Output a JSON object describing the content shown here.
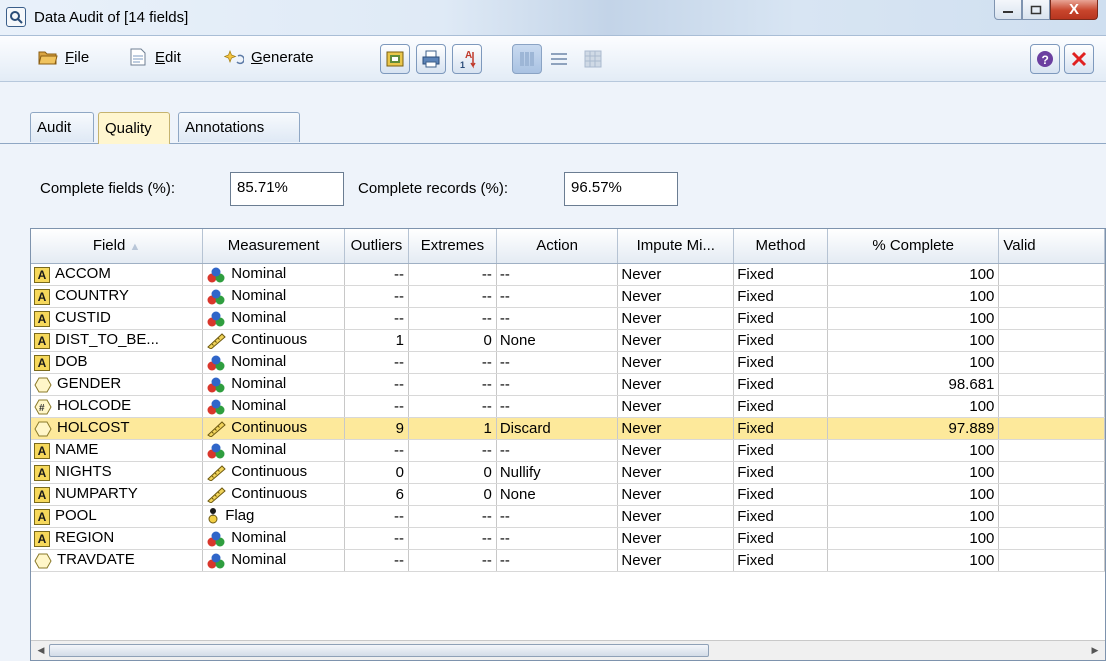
{
  "window": {
    "title": "Data Audit of [14 fields]",
    "minimize_icon": "minimize-icon",
    "maximize_icon": "maximize-icon",
    "close_label": "X"
  },
  "menu": {
    "file": "File",
    "edit": "Edit",
    "generate": "Generate"
  },
  "tabs": [
    {
      "label": "Audit",
      "active": false
    },
    {
      "label": "Quality",
      "active": true
    },
    {
      "label": "Annotations",
      "active": false
    }
  ],
  "complete": {
    "fields_label": "Complete fields (%):",
    "fields_value": "85.71%",
    "records_label": "Complete records (%):",
    "records_value": "96.57%"
  },
  "table": {
    "columns": [
      "Field",
      "Measurement",
      "Outliers",
      "Extremes",
      "Action",
      "Impute Mi...",
      "Method",
      "% Complete",
      "Valid"
    ],
    "rows": [
      {
        "type": "A",
        "field": "ACCOM",
        "measure": "Nominal",
        "mtype": "nominal",
        "outliers": "--",
        "extremes": "--",
        "action": "--",
        "impute": "Never",
        "method": "Fixed",
        "complete": "100",
        "highlight": false
      },
      {
        "type": "A",
        "field": "COUNTRY",
        "measure": "Nominal",
        "mtype": "nominal",
        "outliers": "--",
        "extremes": "--",
        "action": "--",
        "impute": "Never",
        "method": "Fixed",
        "complete": "100",
        "highlight": false
      },
      {
        "type": "A",
        "field": "CUSTID",
        "measure": "Nominal",
        "mtype": "nominal",
        "outliers": "--",
        "extremes": "--",
        "action": "--",
        "impute": "Never",
        "method": "Fixed",
        "complete": "100",
        "highlight": false
      },
      {
        "type": "A",
        "field": "DIST_TO_BE...",
        "measure": "Continuous",
        "mtype": "continuous",
        "outliers": "1",
        "extremes": "0",
        "action": "None",
        "impute": "Never",
        "method": "Fixed",
        "complete": "100",
        "highlight": false
      },
      {
        "type": "A",
        "field": "DOB",
        "measure": "Nominal",
        "mtype": "nominal",
        "outliers": "--",
        "extremes": "--",
        "action": "--",
        "impute": "Never",
        "method": "Fixed",
        "complete": "100",
        "highlight": false
      },
      {
        "type": "diamond",
        "field": "GENDER",
        "measure": "Nominal",
        "mtype": "nominal",
        "outliers": "--",
        "extremes": "--",
        "action": "--",
        "impute": "Never",
        "method": "Fixed",
        "complete": "98.681",
        "highlight": false
      },
      {
        "type": "hash",
        "field": "HOLCODE",
        "measure": "Nominal",
        "mtype": "nominal",
        "outliers": "--",
        "extremes": "--",
        "action": "--",
        "impute": "Never",
        "method": "Fixed",
        "complete": "100",
        "highlight": false
      },
      {
        "type": "diamond",
        "field": "HOLCOST",
        "measure": "Continuous",
        "mtype": "continuous",
        "outliers": "9",
        "extremes": "1",
        "action": "Discard",
        "impute": "Never",
        "method": "Fixed",
        "complete": "97.889",
        "highlight": true
      },
      {
        "type": "A",
        "field": "NAME",
        "measure": "Nominal",
        "mtype": "nominal",
        "outliers": "--",
        "extremes": "--",
        "action": "--",
        "impute": "Never",
        "method": "Fixed",
        "complete": "100",
        "highlight": false
      },
      {
        "type": "A",
        "field": "NIGHTS",
        "measure": "Continuous",
        "mtype": "continuous",
        "outliers": "0",
        "extremes": "0",
        "action": "Nullify",
        "impute": "Never",
        "method": "Fixed",
        "complete": "100",
        "highlight": false
      },
      {
        "type": "A",
        "field": "NUMPARTY",
        "measure": "Continuous",
        "mtype": "continuous",
        "outliers": "6",
        "extremes": "0",
        "action": "None",
        "impute": "Never",
        "method": "Fixed",
        "complete": "100",
        "highlight": false
      },
      {
        "type": "A",
        "field": "POOL",
        "measure": "Flag",
        "mtype": "flag",
        "outliers": "--",
        "extremes": "--",
        "action": "--",
        "impute": "Never",
        "method": "Fixed",
        "complete": "100",
        "highlight": false
      },
      {
        "type": "A",
        "field": "REGION",
        "measure": "Nominal",
        "mtype": "nominal",
        "outliers": "--",
        "extremes": "--",
        "action": "--",
        "impute": "Never",
        "method": "Fixed",
        "complete": "100",
        "highlight": false
      },
      {
        "type": "diamond",
        "field": "TRAVDATE",
        "measure": "Nominal",
        "mtype": "nominal",
        "outliers": "--",
        "extremes": "--",
        "action": "--",
        "impute": "Never",
        "method": "Fixed",
        "complete": "100",
        "highlight": false
      }
    ]
  },
  "colors": {
    "highlight_row": "#fde99b",
    "active_tab": "#fff6cf",
    "close_button": "#c8452c"
  }
}
